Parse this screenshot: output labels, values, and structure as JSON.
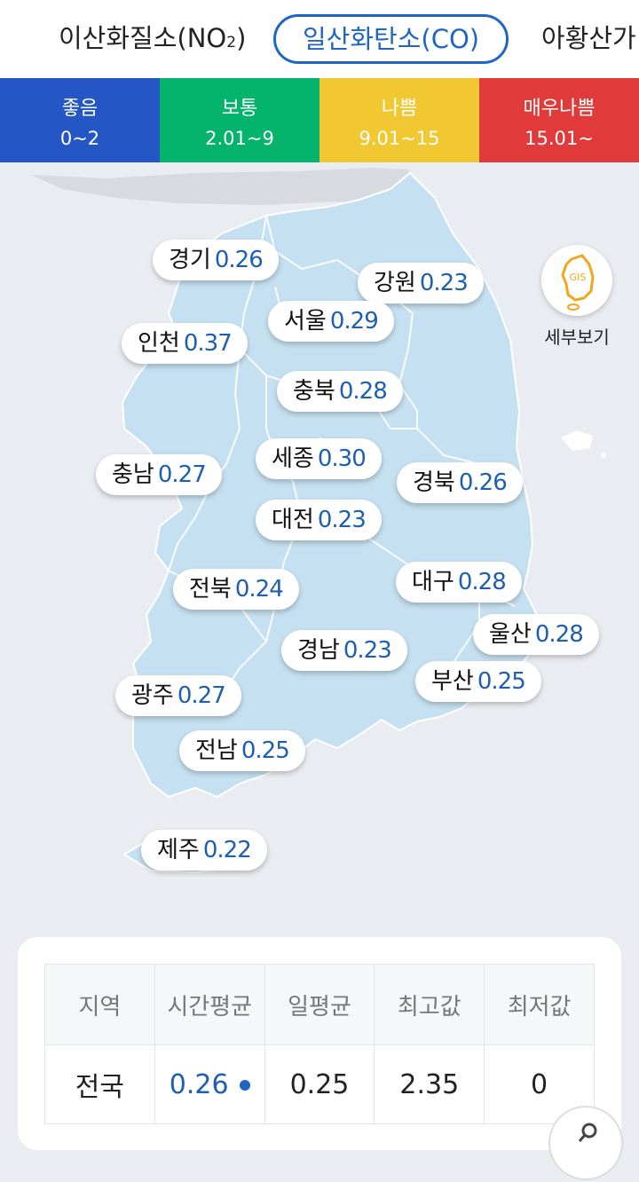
{
  "tabs": [
    {
      "label": "이산화질소(NO",
      "sub": "2",
      "suffix": ")"
    },
    {
      "label": "일산화탄소(CO)"
    },
    {
      "label": "아황산가"
    }
  ],
  "legend": [
    {
      "grade": "좋음",
      "range": "0~2",
      "color": "#2456c6"
    },
    {
      "grade": "보통",
      "range": "2.01~9",
      "color": "#04b36c"
    },
    {
      "grade": "나쁨",
      "range": "9.01~15",
      "color": "#f2c832"
    },
    {
      "grade": "매우나쁨",
      "range": "15.01~",
      "color": "#e03a3a"
    }
  ],
  "regions": [
    {
      "name": "경기",
      "value": "0.26"
    },
    {
      "name": "강원",
      "value": "0.23"
    },
    {
      "name": "서울",
      "value": "0.29"
    },
    {
      "name": "인천",
      "value": "0.37"
    },
    {
      "name": "충북",
      "value": "0.28"
    },
    {
      "name": "세종",
      "value": "0.30"
    },
    {
      "name": "충남",
      "value": "0.27"
    },
    {
      "name": "경북",
      "value": "0.26"
    },
    {
      "name": "대전",
      "value": "0.23"
    },
    {
      "name": "대구",
      "value": "0.28"
    },
    {
      "name": "전북",
      "value": "0.24"
    },
    {
      "name": "울산",
      "value": "0.28"
    },
    {
      "name": "경남",
      "value": "0.23"
    },
    {
      "name": "부산",
      "value": "0.25"
    },
    {
      "name": "광주",
      "value": "0.27"
    },
    {
      "name": "전남",
      "value": "0.25"
    },
    {
      "name": "제주",
      "value": "0.22"
    }
  ],
  "gis": {
    "badge": "GIS",
    "label": "세부보기"
  },
  "table": {
    "headers": [
      "지역",
      "시간평균",
      "일평균",
      "최고값",
      "최저값"
    ],
    "row": {
      "region": "전국",
      "hourly": "0.26",
      "daily": "0.25",
      "max": "2.35",
      "min": "0"
    }
  },
  "colors": {
    "accent": "#1f66c2",
    "map_fill": "#c5e0f0",
    "map_border": "#ffffff"
  }
}
